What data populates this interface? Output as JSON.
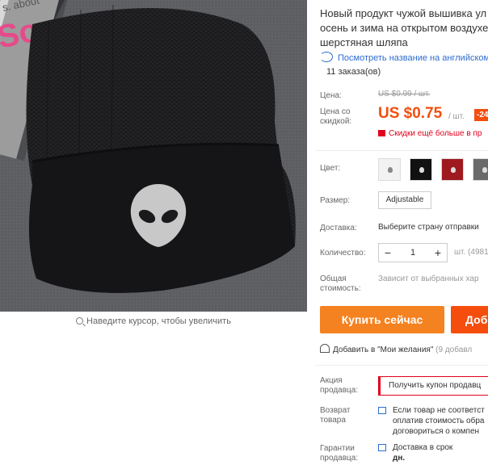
{
  "product": {
    "title": "Новый продукт чужой вышивка ул осень и зима на открытом воздухе шерстяная шляпа",
    "translate_link": "Посмотреть название на английском",
    "orders": "11 заказа(ов)",
    "zoom_hint": "Наведите курсор, чтобы увеличить"
  },
  "pricing": {
    "price_label": "Цена:",
    "old_price": "US $0.99 / шт.",
    "discount_label": "Цена со скидкой:",
    "price": "US $0.75",
    "unit": "/ шт.",
    "discount_badge": "-24",
    "promo_text": "Скидки ещё больше в пр"
  },
  "options": {
    "color_label": "Цвет:",
    "colors": [
      "#ffffff",
      "#111111",
      "#9e1a1f",
      "#555555",
      "#888888"
    ],
    "size_label": "Размер:",
    "size_value": "Adjustable",
    "shipping_label": "Доставка:",
    "shipping_text": "Выберите страну отправки",
    "qty_label": "Количество:",
    "qty_minus": "−",
    "qty_value": "1",
    "qty_plus": "+",
    "qty_available": "шт. (4981",
    "total_label": "Общая стоимость:",
    "total_text": "Зависит от выбранных хар"
  },
  "actions": {
    "buy_now": "Купить сейчас",
    "add_to_cart": "Доб",
    "wishlist": "Добавить в \"Мои желания\"",
    "wishlist_count": "(9 добавл"
  },
  "seller": {
    "promo_label": "Акция продавца:",
    "coupon_button": "Получить купон продавц",
    "return_label": "Возврат товара",
    "return_lines": [
      "Если товар не соответст",
      "оплатив стоимость обра",
      "договориться о компен"
    ],
    "guarantee_label": "Гарантии продавца:",
    "guarantee_lines": [
      "Доставка в срок",
      "дн."
    ]
  }
}
